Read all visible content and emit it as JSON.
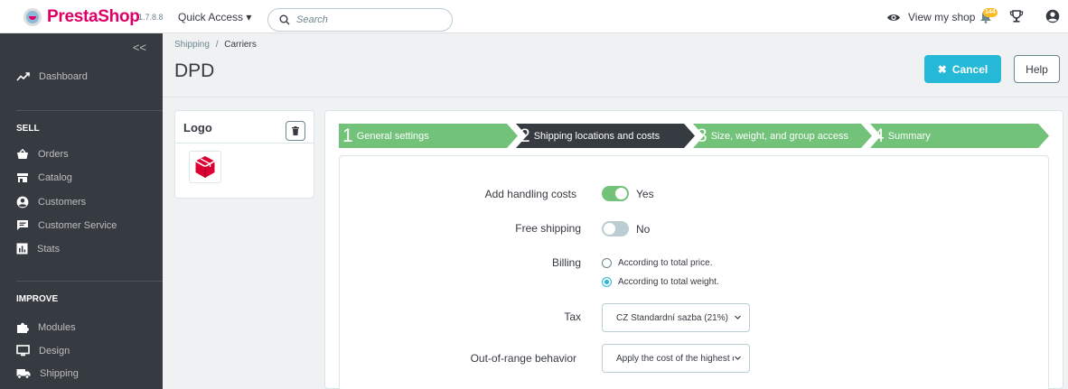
{
  "topbar": {
    "brand": "PrestaShop",
    "version": "1.7.8.8",
    "quick_access": "Quick Access ▾",
    "search_placeholder": "Search",
    "view_shop": "View my shop",
    "notification_count": "144"
  },
  "sidebar": {
    "collapse": "<<",
    "dashboard": "Dashboard",
    "sell_heading": "SELL",
    "sell_items": [
      "Orders",
      "Catalog",
      "Customers",
      "Customer Service",
      "Stats"
    ],
    "improve_heading": "IMPROVE",
    "improve_items": [
      "Modules",
      "Design",
      "Shipping"
    ]
  },
  "header": {
    "breadcrumb_parent": "Shipping",
    "breadcrumb_sep": "/",
    "breadcrumb_current": "Carriers",
    "title": "DPD",
    "cancel_label": "Cancel",
    "help_label": "Help"
  },
  "logo_card": {
    "title": "Logo"
  },
  "steps": [
    {
      "num": "1",
      "label": "General settings",
      "state": "done"
    },
    {
      "num": "2",
      "label": "Shipping locations and costs",
      "state": "active"
    },
    {
      "num": "3",
      "label": "Size, weight, and group access",
      "state": "todo"
    },
    {
      "num": "4",
      "label": "Summary",
      "state": "todo"
    }
  ],
  "form": {
    "handling": {
      "label": "Add handling costs",
      "value_text": "Yes",
      "on": true
    },
    "free_shipping": {
      "label": "Free shipping",
      "value_text": "No",
      "on": false
    },
    "billing": {
      "label": "Billing",
      "options": [
        "According to total price.",
        "According to total weight."
      ],
      "selected": 1
    },
    "tax": {
      "label": "Tax",
      "value": "CZ Standardní sazba (21%)"
    },
    "out_of_range": {
      "label": "Out-of-range behavior",
      "value": "Apply the cost of the highest defined range"
    }
  },
  "colors": {
    "accent": "#25b9d7",
    "brand": "#df0067",
    "step_green": "#72c279",
    "step_active": "#363a41",
    "sidebar_bg": "#363a41"
  }
}
